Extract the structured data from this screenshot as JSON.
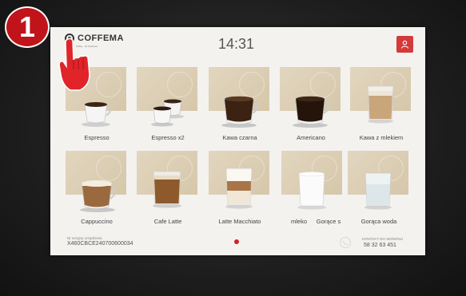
{
  "step": {
    "number": "1"
  },
  "header": {
    "logo_text": "COFFEMA",
    "logo_tagline": "coffee · for business",
    "clock": "14:31"
  },
  "tiles": [
    {
      "label": "Espresso",
      "icon": "espresso-cup-icon"
    },
    {
      "label": "Espresso x2",
      "icon": "double-espresso-cups-icon"
    },
    {
      "label": "Kawa czarna",
      "icon": "black-coffee-cup-icon"
    },
    {
      "label": "Americano",
      "icon": "americano-cup-icon"
    },
    {
      "label": "Kawa z mlekiem",
      "icon": "coffee-with-milk-glass-icon"
    },
    {
      "label": "Cappuccino",
      "icon": "cappuccino-cup-icon"
    },
    {
      "label": "Cafe Latte",
      "icon": "cafe-latte-glass-icon"
    },
    {
      "label": "Latte Macchiato",
      "icon": "latte-macchiato-glass-icon"
    },
    {
      "label": "mleko",
      "icon": "milk-cup-icon"
    },
    {
      "label": "Gorące s",
      "icon": "hot-drink-cup-icon"
    },
    {
      "label": "Gorąca woda",
      "icon": "hot-water-glass-icon"
    }
  ],
  "footer": {
    "serial_caption": "Nr seryjny urządzenia",
    "serial": "X460CBCE240700600034",
    "support_caption": "KONTAKT DO SERWISU",
    "support_phone": "58 32 63 451"
  },
  "colors": {
    "accent": "#d0202a",
    "tile_bg": "#ddd0b8",
    "screen_bg": "#f4f2ef"
  }
}
